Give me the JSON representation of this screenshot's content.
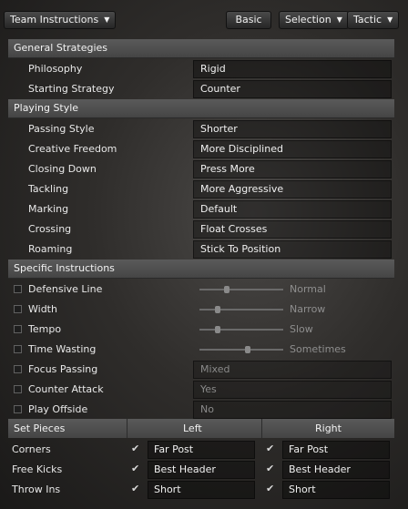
{
  "toolbar": {
    "menu_label": "Team Instructions",
    "basic_label": "Basic",
    "selection_label": "Selection",
    "tactic_label": "Tactic"
  },
  "general": {
    "title": "General Strategies",
    "rows": [
      {
        "label": "Philosophy",
        "value": "Rigid"
      },
      {
        "label": "Starting Strategy",
        "value": "Counter"
      }
    ]
  },
  "playing": {
    "title": "Playing Style",
    "rows": [
      {
        "label": "Passing Style",
        "value": "Shorter"
      },
      {
        "label": "Creative Freedom",
        "value": "More Disciplined"
      },
      {
        "label": "Closing Down",
        "value": "Press More"
      },
      {
        "label": "Tackling",
        "value": "More Aggressive"
      },
      {
        "label": "Marking",
        "value": "Default"
      },
      {
        "label": "Crossing",
        "value": "Float Crosses"
      },
      {
        "label": "Roaming",
        "value": "Stick To Position"
      }
    ]
  },
  "specific": {
    "title": "Specific Instructions",
    "sliders": [
      {
        "label": "Defensive Line",
        "value": "Normal",
        "level": 0.33
      },
      {
        "label": "Width",
        "value": "Narrow",
        "level": 0.22
      },
      {
        "label": "Tempo",
        "value": "Slow",
        "level": 0.22
      },
      {
        "label": "Time Wasting",
        "value": "Sometimes",
        "level": 0.58
      }
    ],
    "selects": [
      {
        "label": "Focus Passing",
        "value": "Mixed"
      },
      {
        "label": "Counter Attack",
        "value": "Yes"
      },
      {
        "label": "Play Offside",
        "value": "No"
      }
    ]
  },
  "set_pieces": {
    "title": "Set Pieces",
    "left_label": "Left",
    "right_label": "Right",
    "rows": [
      {
        "label": "Corners",
        "left": "Far Post",
        "right": "Far Post"
      },
      {
        "label": "Free Kicks",
        "left": "Best Header",
        "right": "Best Header"
      },
      {
        "label": "Throw Ins",
        "left": "Short",
        "right": "Short"
      }
    ],
    "tick": "✔"
  }
}
